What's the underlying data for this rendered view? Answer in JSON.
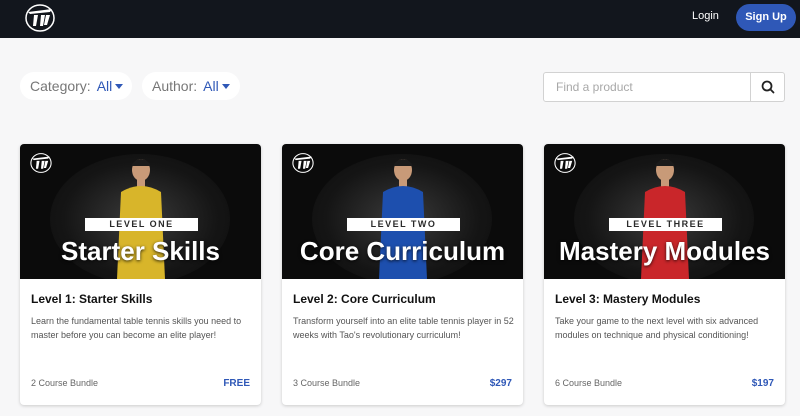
{
  "nav": {
    "login": "Login",
    "signup": "Sign Up"
  },
  "filters": {
    "category": {
      "label": "Category:",
      "value": "All"
    },
    "author": {
      "label": "Author:",
      "value": "All"
    }
  },
  "search": {
    "placeholder": "Find a product",
    "icon": "search-icon"
  },
  "cards": [
    {
      "tag": "LEVEL ONE",
      "banner": "Starter Skills",
      "title": "Level 1: Starter Skills",
      "description": "Learn the fundamental table tennis skills you need to master before you can become an elite player!",
      "bundle": "2 Course Bundle",
      "price": "FREE",
      "shirt_color": "#d8b52a"
    },
    {
      "tag": "LEVEL TWO",
      "banner": "Core Curriculum",
      "title": "Level 2: Core Curriculum",
      "description": "Transform yourself into an elite table tennis player in 52 weeks with Tao's revolutionary curriculum!",
      "bundle": "3 Course Bundle",
      "price": "$297",
      "shirt_color": "#1d4fae"
    },
    {
      "tag": "LEVEL THREE",
      "banner": "Mastery Modules",
      "title": "Level 3: Mastery Modules",
      "description": "Take your game to the next level with six advanced modules on technique and physical conditioning!",
      "bundle": "6 Course Bundle",
      "price": "$197",
      "shirt_color": "#c9262a"
    }
  ],
  "colors": {
    "accent": "#2f58b7",
    "topbar": "#12161d"
  }
}
